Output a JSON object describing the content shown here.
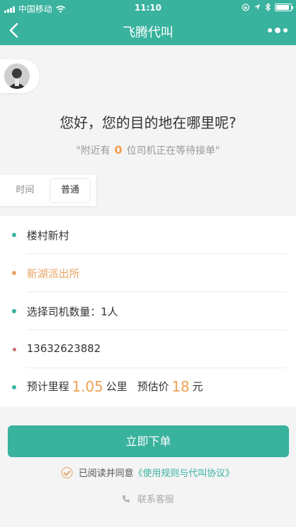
{
  "status_bar": {
    "carrier": "中国移动",
    "time": "11:10"
  },
  "nav": {
    "title": "飞腾代叫"
  },
  "greeting": "您好，您的目的地在哪里呢?",
  "subtitle": {
    "prefix": "\"附近有",
    "count": "0",
    "suffix": "位司机正在等待接单\""
  },
  "tabs": [
    {
      "label": "时间",
      "active": false
    },
    {
      "label": "普通",
      "active": true
    }
  ],
  "form": {
    "start_location": "楼村新村",
    "destination": "新湖派出所",
    "driver_count": "选择司机数量：1人",
    "phone": "13632623882",
    "estimate": {
      "distance_label": "预计里程",
      "distance_value": "1.05",
      "distance_unit": "公里",
      "price_label": "预估价",
      "price_value": "18",
      "price_unit": "元"
    }
  },
  "order_button": "立即下单",
  "agreement": {
    "text": "已阅读并同意",
    "link": "《使用规则与代叫协议》"
  },
  "contact": "联系客服",
  "colors": {
    "primary": "#39b29e",
    "accent": "#f0a052"
  }
}
